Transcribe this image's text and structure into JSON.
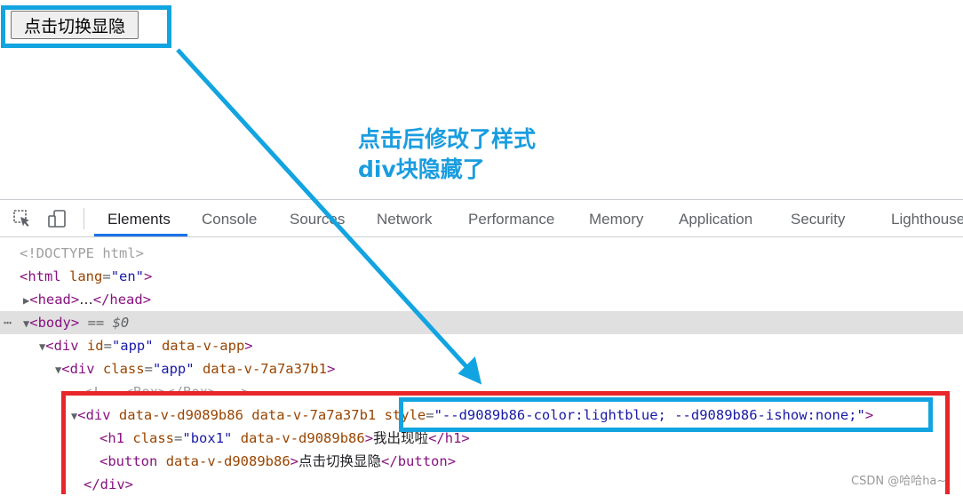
{
  "page": {
    "toggle_button_label": "点击切换显隐"
  },
  "annotation": {
    "line1": "点击后修改了样式",
    "line2": "div块隐藏了"
  },
  "devtools": {
    "tabs": [
      {
        "label": "Elements",
        "active": true
      },
      {
        "label": "Console",
        "active": false
      },
      {
        "label": "Sources",
        "active": false
      },
      {
        "label": "Network",
        "active": false
      },
      {
        "label": "Performance",
        "active": false
      },
      {
        "label": "Memory",
        "active": false
      },
      {
        "label": "Application",
        "active": false
      },
      {
        "label": "Security",
        "active": false
      },
      {
        "label": "Lighthouse",
        "active": false
      }
    ],
    "icons": [
      "inspect-element-icon",
      "device-toolbar-icon"
    ],
    "dom": {
      "doctype": "<!DOCTYPE html>",
      "html_tag": "html",
      "html_attr": "lang",
      "html_val": "\"en\"",
      "head_open": "<head>",
      "head_ellipsis": "…",
      "head_close": "</head>",
      "body_tag": "<body>",
      "body_marker": "== ",
      "body_dollar": "$0",
      "app_tag": "div",
      "app_attr1": "id",
      "app_val1": "\"app\"",
      "app_attr2": "data-v-app",
      "cls_tag": "div",
      "cls_attr1": "class",
      "cls_val1": "\"app\"",
      "cls_attr2": "data-v-7a7a37b1",
      "comment": "<!-- <Box></Box> -->",
      "box_tag": "div",
      "box_attr1": "data-v-d9089b86",
      "box_attr2": "data-v-7a7a37b1",
      "box_style_attr": "style",
      "box_style_val": "\"--d9089b86-color:lightblue; --d9089b86-ishow:none;\"",
      "h1_tag": "h1",
      "h1_attr1": "class",
      "h1_val1": "\"box1\"",
      "h1_attr2": "data-v-d9089b86",
      "h1_text": "我出现啦",
      "button_tag": "button",
      "button_attr": "data-v-d9089b86",
      "button_text": "点击切换显隐",
      "div_close": "</div>"
    }
  },
  "watermark": "CSDN @哈哈ha~",
  "colors": {
    "highlight_blue": "#12a4e0",
    "highlight_red": "#e8262a",
    "annotation_text": "#1a9ddf",
    "active_tab_underline": "#1a73e8"
  }
}
